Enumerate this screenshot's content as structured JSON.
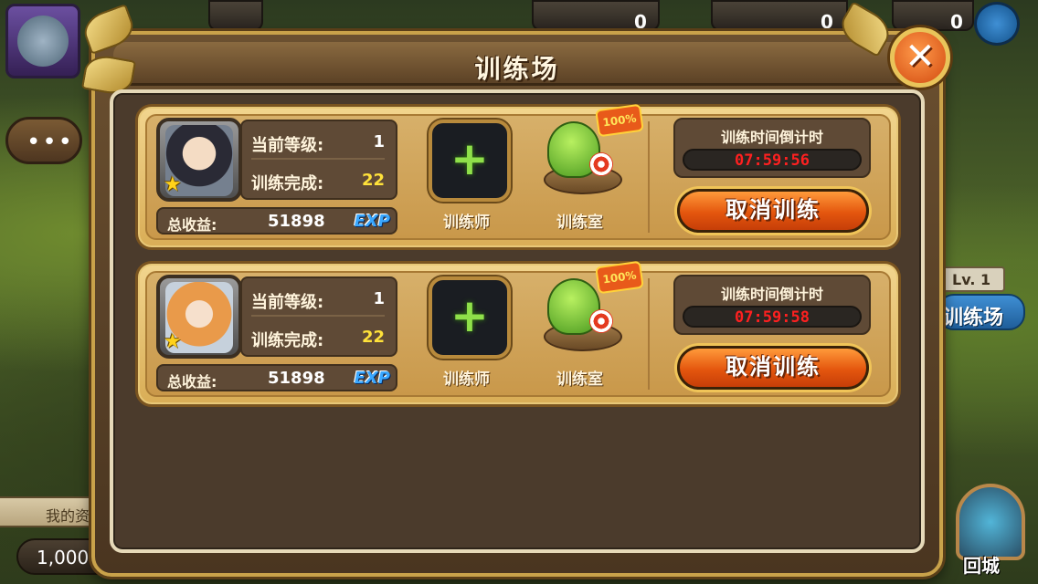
{
  "dialog": {
    "title": "训练场",
    "close_symbol": "✕"
  },
  "background_hud": {
    "top_counter_1": "0",
    "top_counter_2": "0",
    "top_counter_3": "0",
    "chat_symbol": "•••",
    "my_resources_label": "我的资",
    "money_value": "1,000",
    "building_level": "Lv. 1",
    "building_name": "训练场",
    "return_city_label": "回城"
  },
  "slots": [
    {
      "level_label": "当前等级:",
      "level_value": "1",
      "completed_label": "训练完成:",
      "completed_value": "22",
      "income_label": "总收益:",
      "income_value": "51898",
      "exp_badge": "EXP",
      "trainer_label": "训练师",
      "room_label": "训练室",
      "room_badge": "100%",
      "timer_label": "训练时间倒计时",
      "timer_value": "07:59:56",
      "cancel_label": "取消训练",
      "star": "★"
    },
    {
      "level_label": "当前等级:",
      "level_value": "1",
      "completed_label": "训练完成:",
      "completed_value": "22",
      "income_label": "总收益:",
      "income_value": "51898",
      "exp_badge": "EXP",
      "trainer_label": "训练师",
      "room_label": "训练室",
      "room_badge": "100%",
      "timer_label": "训练时间倒计时",
      "timer_value": "07:59:58",
      "cancel_label": "取消训练",
      "star": "★"
    }
  ],
  "colors": {
    "timer_text": "#ff2020",
    "completed_value": "#ffe23a",
    "exp_badge": "#3aa8ff",
    "cancel_button": "#e4560e",
    "plus_icon": "#8fe04a"
  },
  "icons": {
    "close": "close-icon",
    "add_trainer": "plus-icon",
    "star": "star-icon",
    "room": "tree-island-icon",
    "friends": "friends-icon",
    "chat": "chat-icon",
    "portal": "portal-icon"
  }
}
